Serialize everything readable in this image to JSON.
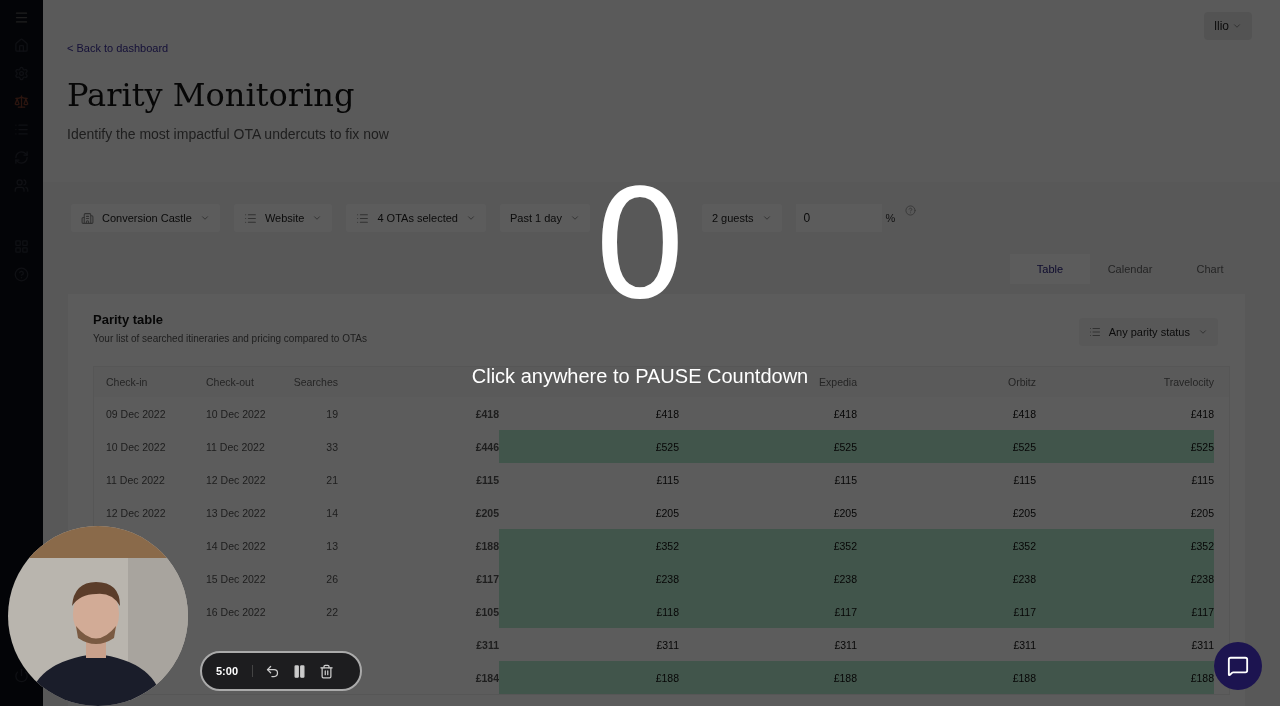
{
  "user_menu": {
    "label": "llio"
  },
  "back_link": "< Back to dashboard",
  "title": "Parity Monitoring",
  "subtitle": "Identify the most impactful OTA undercuts to fix now",
  "filters": [
    {
      "kind": "building",
      "label": "Conversion Castle"
    },
    {
      "kind": "list",
      "label": "Website"
    },
    {
      "kind": "list",
      "label": "4 OTAs selected"
    },
    {
      "kind": "plain",
      "label": "Past 1 day"
    },
    {
      "kind": "gap"
    },
    {
      "kind": "plain",
      "label": "2 guests"
    }
  ],
  "threshold": {
    "value": "0",
    "unit": "%"
  },
  "view_tabs": [
    {
      "label": "Table",
      "selected": true
    },
    {
      "label": "Calendar",
      "selected": false
    },
    {
      "label": "Chart",
      "selected": false
    }
  ],
  "card": {
    "title": "Parity table",
    "subtitle": "Your list of searched itineraries and pricing compared to OTAs",
    "status_filter": "Any parity status"
  },
  "table": {
    "columns": [
      "Check-in",
      "Check-out",
      "Searches",
      null,
      null,
      "Expedia",
      "Orbitz",
      "Travelocity"
    ],
    "rows": [
      {
        "cells": [
          "09 Dec 2022",
          "10 Dec 2022",
          "19",
          "£418",
          "£418",
          "£418",
          "£418",
          "£418"
        ],
        "undercut": false
      },
      {
        "cells": [
          "10 Dec 2022",
          "11 Dec 2022",
          "33",
          "£446",
          "£525",
          "£525",
          "£525",
          "£525"
        ],
        "undercut": true
      },
      {
        "cells": [
          "11 Dec 2022",
          "12 Dec 2022",
          "21",
          "£115",
          "£115",
          "£115",
          "£115",
          "£115"
        ],
        "undercut": false
      },
      {
        "cells": [
          "12 Dec 2022",
          "13 Dec 2022",
          "14",
          "£205",
          "£205",
          "£205",
          "£205",
          "£205"
        ],
        "undercut": false
      },
      {
        "cells": [
          null,
          "14 Dec 2022",
          "13",
          "£188",
          "£352",
          "£352",
          "£352",
          "£352"
        ],
        "undercut": true
      },
      {
        "cells": [
          null,
          "15 Dec 2022",
          "26",
          "£117",
          "£238",
          "£238",
          "£238",
          "£238"
        ],
        "undercut": true
      },
      {
        "cells": [
          null,
          "16 Dec 2022",
          "22",
          "£105",
          "£118",
          "£117",
          "£117",
          "£117"
        ],
        "undercut": true
      },
      {
        "cells": [
          null,
          null,
          null,
          "£311",
          "£311",
          "£311",
          "£311",
          "£311"
        ],
        "undercut": false
      },
      {
        "cells": [
          null,
          null,
          null,
          "£184",
          "£188",
          "£188",
          "£188",
          "£188"
        ],
        "undercut": true
      }
    ]
  },
  "countdown": {
    "number": "0",
    "hint": "Click anywhere to PAUSE Countdown"
  },
  "recorder": {
    "time": "5:00"
  }
}
